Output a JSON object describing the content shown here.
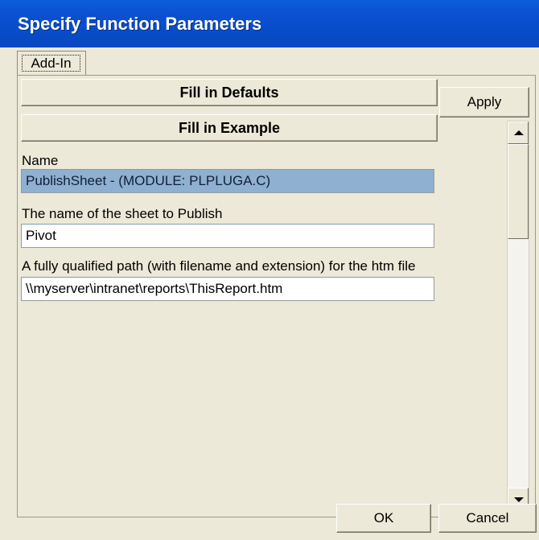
{
  "window": {
    "title": "Specify Function Parameters"
  },
  "tabs": [
    {
      "label": "Add-In",
      "selected": true
    }
  ],
  "buttons": {
    "fill_defaults": "Fill in Defaults",
    "fill_example": "Fill in Example",
    "apply": "Apply",
    "ok": "OK",
    "cancel": "Cancel"
  },
  "fields": {
    "name": {
      "label": "Name",
      "value": "PublishSheet - (MODULE: PLPLUGA.C)"
    },
    "sheet": {
      "label": "The name of the sheet to Publish",
      "value": "Pivot"
    },
    "path": {
      "label": "A fully qualified path (with filename and extension) for the htm file",
      "value": "\\\\myserver\\intranet\\reports\\ThisReport.htm"
    }
  },
  "scrollbar": {
    "up_icon": "arrow-up-icon",
    "down_icon": "arrow-down-icon"
  },
  "colors": {
    "title_bar": "#0a50d0",
    "dialog_bg": "#ece9d8",
    "selected_field_bg": "#8fb0d0"
  }
}
